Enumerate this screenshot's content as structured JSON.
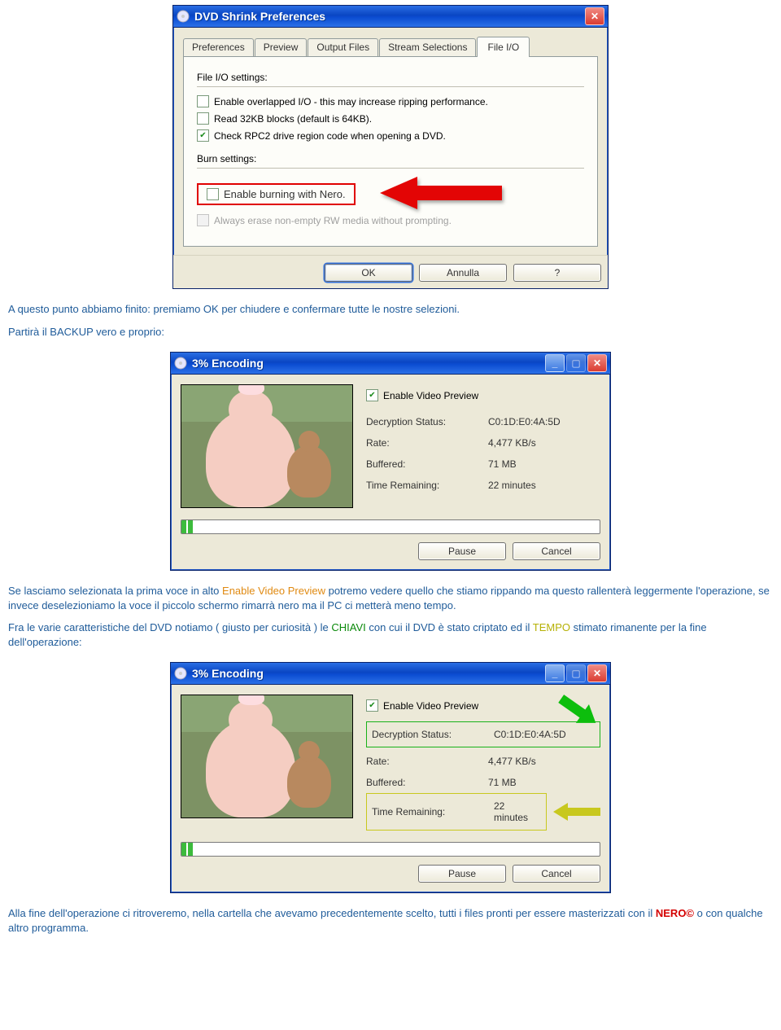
{
  "prefs": {
    "title": "DVD Shrink Preferences",
    "tabs": [
      "Preferences",
      "Preview",
      "Output Files",
      "Stream Selections",
      "File I/O"
    ],
    "active_tab": "File I/O",
    "section_io": "File I/O settings:",
    "opt_overlap": "Enable overlapped I/O - this may increase ripping performance.",
    "opt_32kb": "Read 32KB blocks (default is 64KB).",
    "opt_rpc2": "Check RPC2 drive region code when opening a DVD.",
    "section_burn": "Burn settings:",
    "opt_nero": "Enable burning with Nero.",
    "opt_erase": "Always erase non-empty RW media without prompting.",
    "btn_ok": "OK",
    "btn_cancel": "Annulla",
    "btn_help": "?"
  },
  "para1": "A questo punto abbiamo finito: premiamo OK per chiudere e confermare tutte le nostre selezioni.",
  "para2": "Partirà il BACKUP vero e proprio:",
  "enc": {
    "title": "3% Encoding",
    "preview_label": "Enable Video Preview",
    "k_decrypt": "Decryption Status:",
    "v_decrypt": "C0:1D:E0:4A:5D",
    "k_rate": "Rate:",
    "v_rate": "4,477 KB/s",
    "k_buf": "Buffered:",
    "v_buf": "71 MB",
    "k_time": "Time Remaining:",
    "v_time": "22 minutes",
    "btn_pause": "Pause",
    "btn_cancel": "Cancel"
  },
  "para3a": "Se lasciamo selezionata la prima voce in alto ",
  "para3_evo": "Enable Video Preview",
  "para3b": " potremo vedere quello che stiamo rippando ma questo rallenterà leggermente l'operazione, se invece deselezioniamo la voce il piccolo schermo rimarrà nero ma il PC ci metterà meno tempo.",
  "para4a": "Fra le varie caratteristiche del DVD notiamo ( giusto per curiosità ) le ",
  "para4_chiavi": "CHIAVI",
  "para4b": " con cui il DVD è stato criptato ed il ",
  "para4_tempo": "TEMPO",
  "para4c": " stimato rimanente per la fine dell'operazione:",
  "para5a": "Alla fine dell'operazione ci ritroveremo, nella cartella che avevamo precedentemente scelto, tutti i files pronti per essere masterizzati con il ",
  "para5_nero": "NERO©",
  "para5b": " o con qualche altro programma."
}
